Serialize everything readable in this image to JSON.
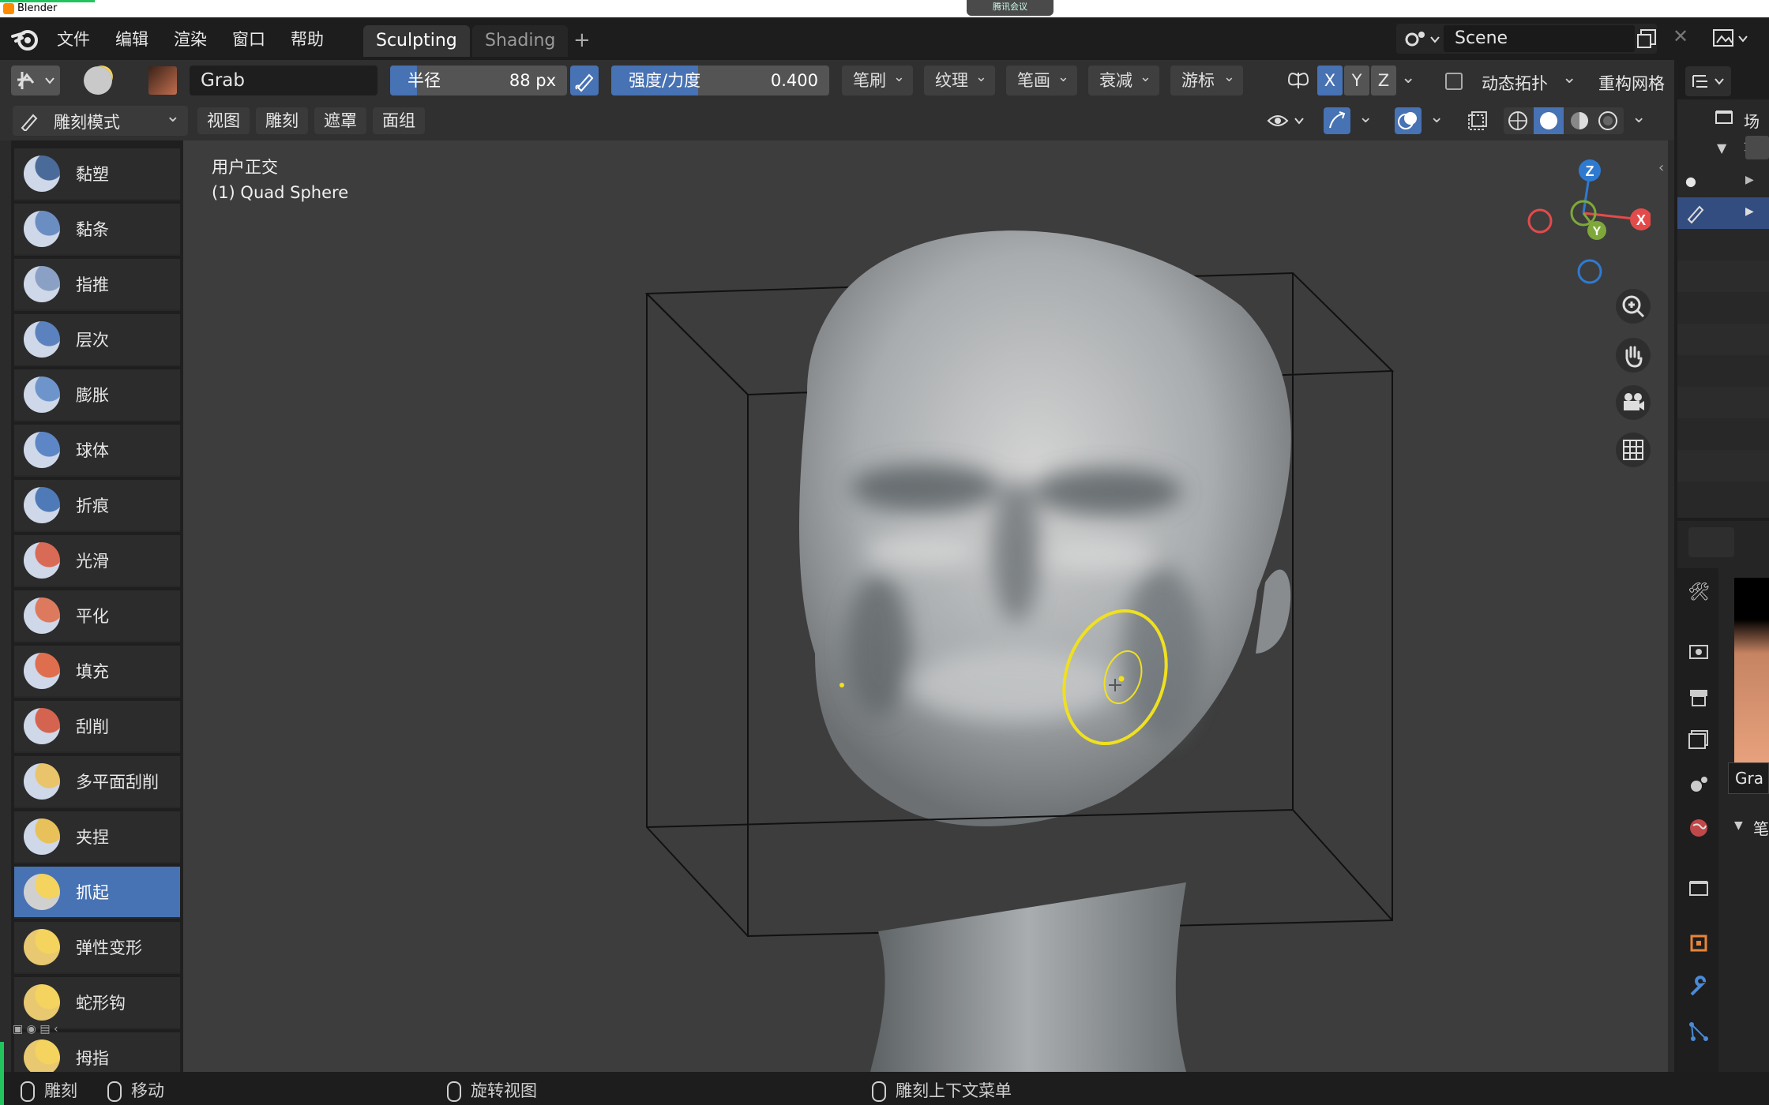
{
  "window": {
    "title": "Blender",
    "meeting_badge": "腾讯会议"
  },
  "menu": [
    "文件",
    "编辑",
    "渲染",
    "窗口",
    "帮助"
  ],
  "workspaces": [
    {
      "label": "Sculpting",
      "active": true
    },
    {
      "label": "Shading",
      "active": false
    }
  ],
  "add_tab": "+",
  "scene": {
    "name": "Scene"
  },
  "tool_header": {
    "brush_name": "Grab",
    "radius": {
      "label": "半径",
      "value": "88 px"
    },
    "strength": {
      "label": "强度/力度",
      "value": "0.400",
      "fraction": 0.4
    },
    "dropdowns": [
      "笔刷",
      "纹理",
      "笔画",
      "衰减",
      "游标"
    ],
    "axes": [
      "X",
      "Y",
      "Z"
    ],
    "dyntopo": "动态拓扑",
    "remesh": "重构网格"
  },
  "mode_header": {
    "mode": "雕刻模式",
    "menus": [
      "视图",
      "雕刻",
      "遮罩",
      "面组"
    ]
  },
  "viewport": {
    "view_label": "用户正交",
    "object_label": "(1) Quad Sphere"
  },
  "gizmo": {
    "z": "Z",
    "y": "Y",
    "x": "X"
  },
  "tools": [
    {
      "label": "黏塑",
      "icon": "clay-brush-icon",
      "active": false
    },
    {
      "label": "黏条",
      "icon": "clay-strips-brush-icon",
      "active": false
    },
    {
      "label": "指推",
      "icon": "smear-brush-icon",
      "active": false
    },
    {
      "label": "层次",
      "icon": "layer-brush-icon",
      "active": false
    },
    {
      "label": "膨胀",
      "icon": "inflate-brush-icon",
      "active": false
    },
    {
      "label": "球体",
      "icon": "blob-brush-icon",
      "active": false
    },
    {
      "label": "折痕",
      "icon": "crease-brush-icon",
      "active": false
    },
    {
      "label": "光滑",
      "icon": "smooth-brush-icon",
      "active": false
    },
    {
      "label": "平化",
      "icon": "flatten-brush-icon",
      "active": false
    },
    {
      "label": "填充",
      "icon": "fill-brush-icon",
      "active": false
    },
    {
      "label": "刮削",
      "icon": "scrape-brush-icon",
      "active": false
    },
    {
      "label": "多平面刮削",
      "icon": "multiplane-scrape-brush-icon",
      "active": false
    },
    {
      "label": "夹捏",
      "icon": "pinch-brush-icon",
      "active": false
    },
    {
      "label": "抓起",
      "icon": "grab-brush-icon",
      "active": true
    },
    {
      "label": "弹性变形",
      "icon": "elastic-deform-brush-icon",
      "active": false
    },
    {
      "label": "蛇形钩",
      "icon": "snake-hook-brush-icon",
      "active": false
    },
    {
      "label": "拇指",
      "icon": "thumb-brush-icon",
      "active": false
    }
  ],
  "outliner": {
    "title": "场景"
  },
  "properties": {
    "brush_field": "Gra",
    "section": "笔"
  },
  "status": [
    {
      "label": "雕刻"
    },
    {
      "label": "移动"
    },
    {
      "label": "旋转视图"
    },
    {
      "label": "雕刻上下文菜单"
    }
  ],
  "colors": {
    "accent": "#4772b3",
    "x_axis": "#e34b4b",
    "y_axis": "#7fa83a",
    "z_axis": "#2f7ad1",
    "brush_cursor": "#f0e020"
  }
}
